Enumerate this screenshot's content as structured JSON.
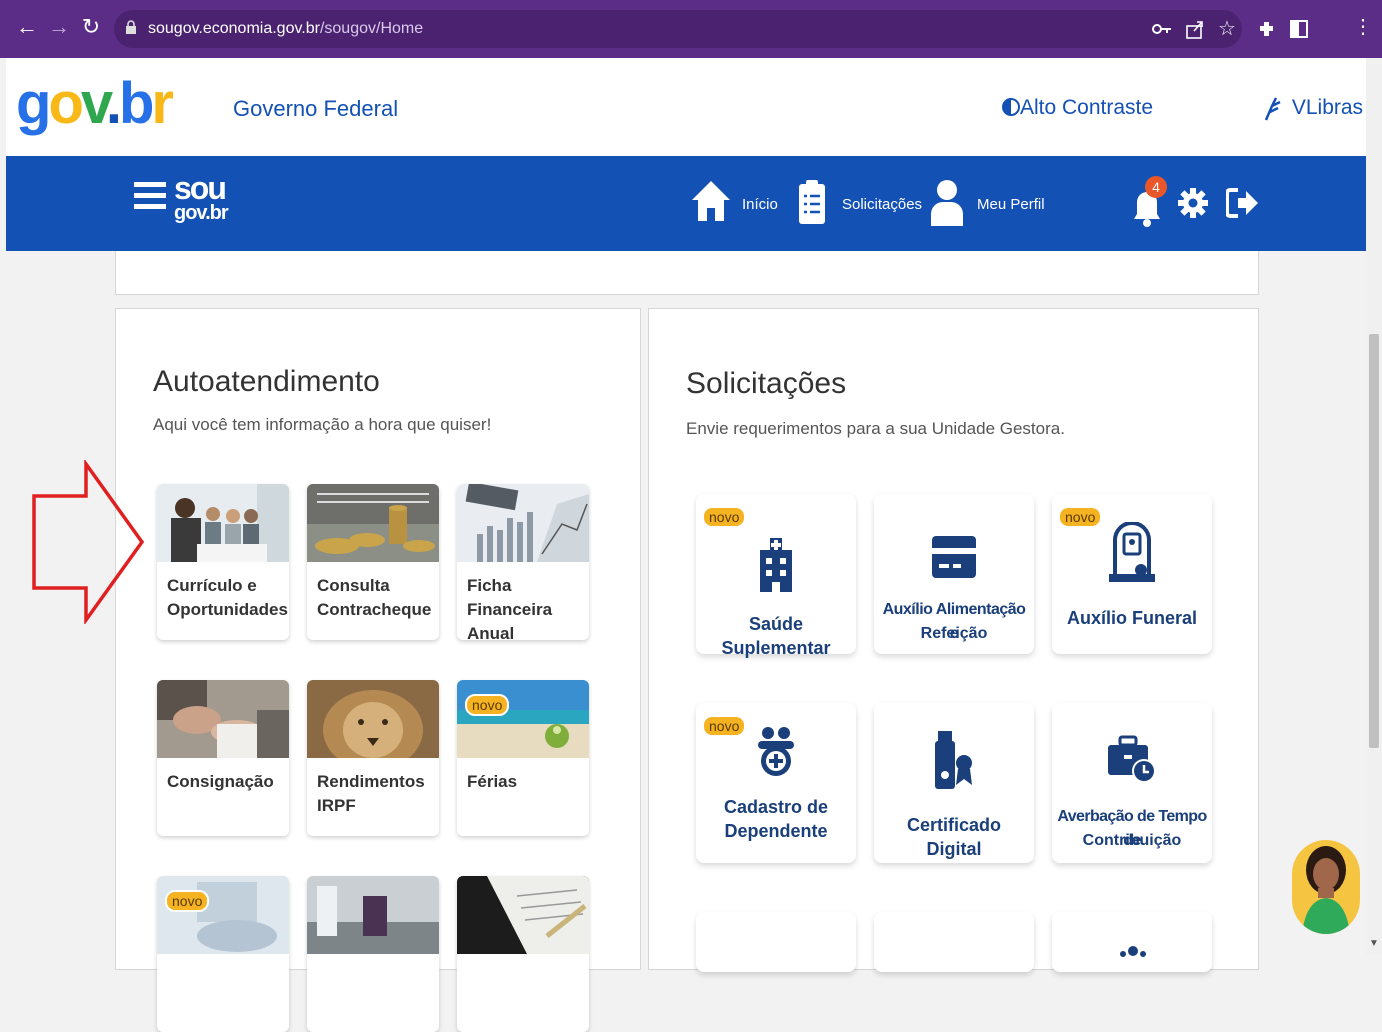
{
  "browser": {
    "url_host": "sougov.economia.gov.br",
    "url_path": "/sougov/Home"
  },
  "header": {
    "logo": "gov.br",
    "gov_label": "Governo Federal",
    "contrast_label": "Alto Contraste",
    "vlibras_label": "VLibras"
  },
  "navbar": {
    "brand_top": "sou",
    "brand_bottom": "gov.br",
    "items": [
      {
        "label": "Início",
        "icon": "home-icon"
      },
      {
        "label": "Solicitações",
        "icon": "clipboard-icon"
      },
      {
        "label": "Meu Perfil",
        "icon": "user-icon"
      }
    ],
    "notification_count": "4"
  },
  "autoatendimento": {
    "title": "Autoatendimento",
    "subtitle": "Aqui você tem informação a hora que quiser!",
    "tiles": [
      {
        "line1": "Currículo e",
        "line2": "Oportunidades",
        "badge": ""
      },
      {
        "line1": "Consulta",
        "line2": "Contracheque",
        "badge": ""
      },
      {
        "line1": "Ficha Financeira",
        "line2": "Anual",
        "badge": ""
      },
      {
        "line1": "Consignação",
        "line2": "",
        "badge": ""
      },
      {
        "line1": "Rendimentos",
        "line2": "IRPF",
        "badge": ""
      },
      {
        "line1": "Férias",
        "line2": "",
        "badge": "novo"
      },
      {
        "line1": "",
        "line2": "",
        "badge": "novo"
      }
    ]
  },
  "solicitacoes": {
    "title": "Solicitações",
    "subtitle": "Envie requerimentos para a sua Unidade Gestora.",
    "cards": [
      {
        "line1": "Saúde Suplementar",
        "line2": "",
        "badge": "novo",
        "icon": "hospital-icon"
      },
      {
        "line1": "Auxílio Alimentação e",
        "line2": "Refeição",
        "badge": "",
        "icon": "card-icon"
      },
      {
        "line1": "Auxílio Funeral",
        "line2": "",
        "badge": "novo",
        "icon": "funeral-icon"
      },
      {
        "line1": "Cadastro de",
        "line2": "Dependente",
        "badge": "novo",
        "icon": "dependent-icon"
      },
      {
        "line1": "Certificado Digital",
        "line2": "",
        "badge": "",
        "icon": "certificate-icon"
      },
      {
        "line1": "Averbação de Tempo de",
        "line2": "Contribuição",
        "badge": "",
        "icon": "briefcase-clock-icon"
      }
    ]
  },
  "colors": {
    "chrome": "#5b2d86",
    "gov_blue": "#1351b4",
    "badge": "#f5b321",
    "arrow": "#e02020"
  }
}
